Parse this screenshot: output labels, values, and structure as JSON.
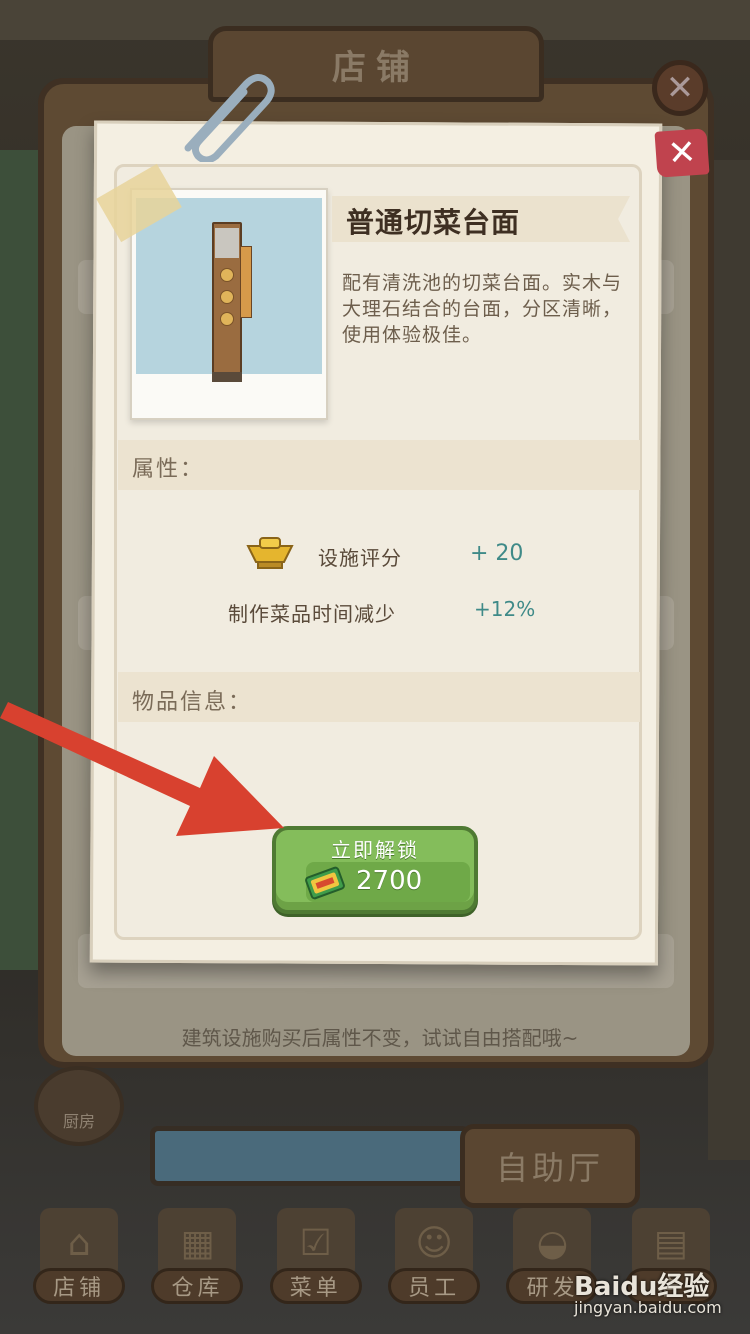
{
  "background": {
    "shop_title": "店铺",
    "hint": "建筑设施购买后属性不变，试试自由搭配哦~",
    "kitchen_badge": "厨房",
    "buffet_sign": "自助厅"
  },
  "bottom_nav": [
    {
      "label": "店铺",
      "icon": "shop-icon"
    },
    {
      "label": "仓库",
      "icon": "warehouse-icon"
    },
    {
      "label": "菜单",
      "icon": "menu-icon"
    },
    {
      "label": "员工",
      "icon": "staff-icon"
    },
    {
      "label": "研发",
      "icon": "research-icon"
    },
    {
      "label": "店",
      "icon": "store-icon"
    }
  ],
  "item_card": {
    "title": "普通切菜台面",
    "description": "配有清洗池的切菜台面。实木与大理石结合的台面，分区清晰，使用体验极佳。",
    "attributes_header": "属性：",
    "stats": [
      {
        "label": "设施评分",
        "value": "+ 20",
        "icon": "gold-ingot-icon"
      },
      {
        "label": "制作菜品时间减少",
        "value": "+12%"
      }
    ],
    "info_header": "物品信息：",
    "unlock": {
      "label": "立即解锁",
      "price": "2700",
      "currency_icon": "cash-icon"
    }
  },
  "watermark": {
    "logo": "Baidu经验",
    "url": "jingyan.baidu.com"
  },
  "colors": {
    "button_green": "#84bd5b",
    "stat_value": "#3f8a88",
    "close_red": "#c0434e",
    "arrow_red": "#d8412f"
  }
}
